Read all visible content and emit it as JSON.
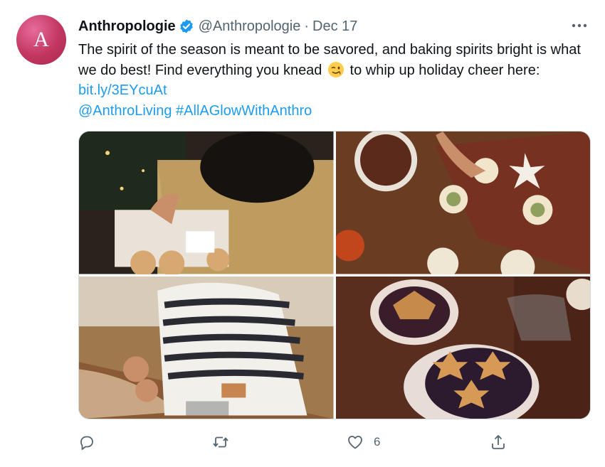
{
  "tweet": {
    "avatar_letter": "A",
    "author_name": "Anthropologie",
    "handle": "@Anthropologie",
    "separator": "·",
    "date": "Dec 17",
    "text_part1": "The spirit of the season is meant to be savored, and baking spirits bright is what we do best! Find everything you knead",
    "text_part2": " to whip up holiday cheer here: ",
    "link": "bit.ly/3EYcuAt",
    "mention": "@AnthroLiving",
    "hashtag": "#AllAGlowWithAnthro",
    "emoji_name": "winking-face",
    "likes_count": "6"
  },
  "colors": {
    "link": "#1d9bf0",
    "secondary_text": "#536471",
    "verified_badge": "#1d9bf0",
    "avatar": "#c2365f"
  },
  "icons": {
    "more": "more-horizontal-icon",
    "reply": "reply-icon",
    "retweet": "retweet-icon",
    "like": "heart-icon",
    "share": "share-icon"
  }
}
